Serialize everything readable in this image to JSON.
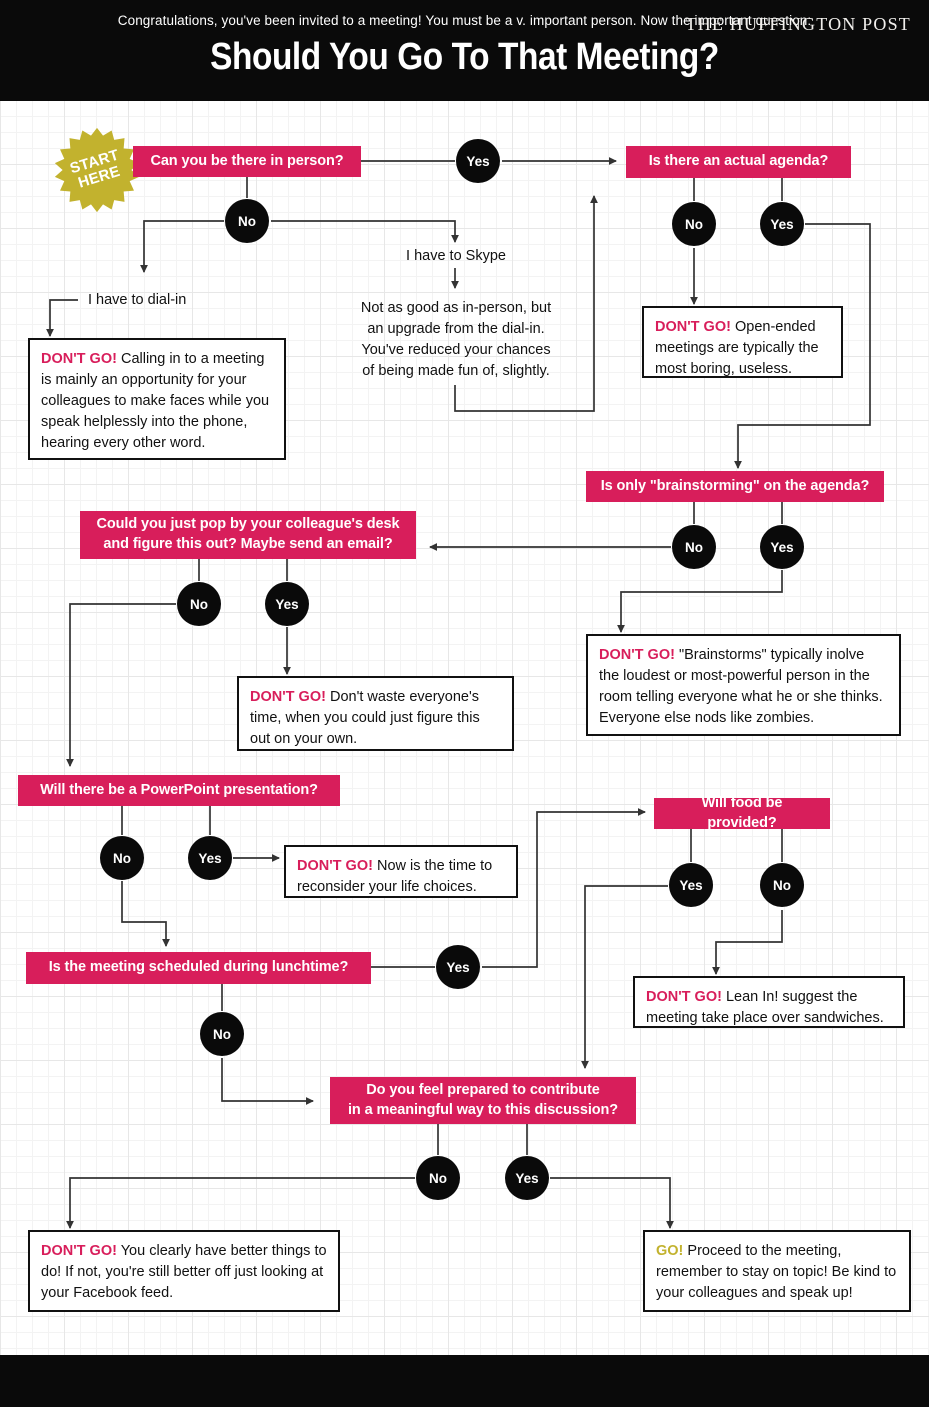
{
  "header": {
    "kicker": "Congratulations, you've been invited to a meeting! You must be a v. important person. Now the important question:",
    "title": "Should You Go To That Meeting?"
  },
  "footer": {
    "brand": "THE HUFFINGTON POST"
  },
  "start_badge": {
    "line1": "START",
    "line2": "HERE"
  },
  "colors": {
    "pink": "#d81e5b",
    "gold": "#c2b22e",
    "black": "#0a0a0a",
    "paper": "#ffffff",
    "grid": "#e7e7e7"
  },
  "questions": {
    "in_person": "Can you be there in person?",
    "agenda": "Is there an actual agenda?",
    "brainstorming": "Is only \"brainstorming\" on the agenda?",
    "colleague_desk_l1": "Could you just pop by your colleague's desk",
    "colleague_desk_l2": "and figure this out? Maybe send an email?",
    "powerpoint": "Will there be a PowerPoint presentation?",
    "lunchtime": "Is the meeting scheduled during lunchtime?",
    "food": "Will food be provided?",
    "prepared_l1": "Do you feel prepared to contribute",
    "prepared_l2": "in a meaningful way to this discussion?"
  },
  "nodes": {
    "in_person_yes": "Yes",
    "in_person_no": "No",
    "agenda_no": "No",
    "agenda_yes": "Yes",
    "brainstorm_no": "No",
    "brainstorm_yes": "Yes",
    "desk_no": "No",
    "desk_yes": "Yes",
    "ppt_no": "No",
    "ppt_yes": "Yes",
    "lunch_yes": "Yes",
    "lunch_no": "No",
    "food_yes": "Yes",
    "food_no": "No",
    "prepared_no": "No",
    "prepared_yes": "Yes"
  },
  "labels": {
    "dial_in": "I have to dial-in",
    "skype": "I have to Skype",
    "skype_note_l1": "Not as good as in-person, but",
    "skype_note_l2": "an upgrade from the dial-in.",
    "skype_note_l3": "You've reduced your chances",
    "skype_note_l4": "of being made fun of, slightly."
  },
  "outcomes": {
    "dial_in": {
      "tag": "DON'T GO!",
      "text": " Calling in to a meeting is mainly an opportunity for your colleagues to make faces while you speak helplessly into the phone, hearing every other word."
    },
    "no_agenda": {
      "tag": "DON'T GO!",
      "text": "  Open-ended meetings are typically the most boring, useless."
    },
    "brainstorm": {
      "tag": "DON'T GO!",
      "text": " \"Brainstorms\" typically inolve the loudest or most-powerful person in the room telling everyone what he or she thinks. Everyone else nods like zombies."
    },
    "desk": {
      "tag": "DON'T GO!",
      "text": " Don't waste everyone's time, when you could just figure this out on your own."
    },
    "powerpoint": {
      "tag": "DON'T GO!",
      "text": " Now is the time to reconsider your life choices."
    },
    "no_food": {
      "tag": "DON'T GO!",
      "text": " Lean In! suggest the meeting take place over sandwiches."
    },
    "not_prepared": {
      "tag": "DON'T GO!",
      "text": " You clearly have better things to do! If not, you're still better off just looking at your Facebook feed."
    },
    "go": {
      "tag": "GO!",
      "text": " Proceed to the meeting, remember to stay on topic! Be kind to your colleagues and speak up!"
    }
  },
  "chart_data": {
    "type": "diagram",
    "title": "Should You Go To That Meeting?",
    "flow": [
      {
        "from": "Can you be there in person?",
        "answer": "No",
        "to": "I have to dial-in"
      },
      {
        "from": "Can you be there in person?",
        "answer": "No",
        "to": "I have to Skype"
      },
      {
        "from": "Can you be there in person?",
        "answer": "Yes",
        "to": "Is there an actual agenda?"
      },
      {
        "from": "I have to dial-in",
        "answer": "",
        "to": "DON'T GO! (calling in)"
      },
      {
        "from": "I have to Skype",
        "answer": "",
        "to": "Is there an actual agenda?"
      },
      {
        "from": "Is there an actual agenda?",
        "answer": "No",
        "to": "DON'T GO! (open-ended)"
      },
      {
        "from": "Is there an actual agenda?",
        "answer": "Yes",
        "to": "Is only \"brainstorming\" on the agenda?"
      },
      {
        "from": "Is only \"brainstorming\" on the agenda?",
        "answer": "Yes",
        "to": "DON'T GO! (brainstorms)"
      },
      {
        "from": "Is only \"brainstorming\" on the agenda?",
        "answer": "No",
        "to": "Could you just pop by your colleague's desk and figure this out? Maybe send an email?"
      },
      {
        "from": "Could you just pop by your colleague's desk and figure this out? Maybe send an email?",
        "answer": "Yes",
        "to": "DON'T GO! (waste time)"
      },
      {
        "from": "Could you just pop by your colleague's desk and figure this out? Maybe send an email?",
        "answer": "No",
        "to": "Will there be a PowerPoint presentation?"
      },
      {
        "from": "Will there be a PowerPoint presentation?",
        "answer": "Yes",
        "to": "DON'T GO! (life choices)"
      },
      {
        "from": "Will there be a PowerPoint presentation?",
        "answer": "No",
        "to": "Is the meeting scheduled during lunchtime?"
      },
      {
        "from": "Is the meeting scheduled during lunchtime?",
        "answer": "Yes",
        "to": "Will food be provided?"
      },
      {
        "from": "Is the meeting scheduled during lunchtime?",
        "answer": "No",
        "to": "Do you feel prepared to contribute in a meaningful way to this discussion?"
      },
      {
        "from": "Will food be provided?",
        "answer": "No",
        "to": "DON'T GO! (Lean In! sandwiches)"
      },
      {
        "from": "Will food be provided?",
        "answer": "Yes",
        "to": "Do you feel prepared to contribute in a meaningful way to this discussion?"
      },
      {
        "from": "Do you feel prepared to contribute in a meaningful way to this discussion?",
        "answer": "No",
        "to": "DON'T GO! (better things to do)"
      },
      {
        "from": "Do you feel prepared to contribute in a meaningful way to this discussion?",
        "answer": "Yes",
        "to": "GO!"
      }
    ]
  }
}
